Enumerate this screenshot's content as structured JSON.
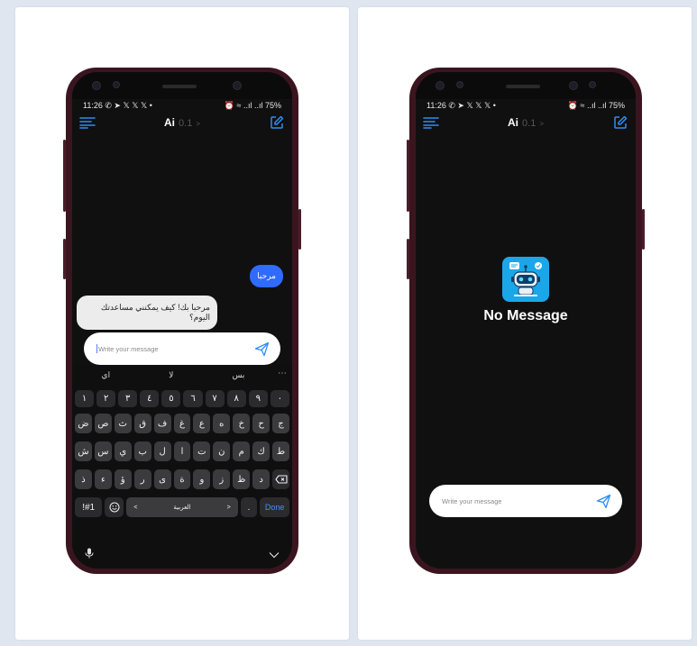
{
  "colors": {
    "accent": "#2f6bff",
    "icon_blue": "#2e8ef3",
    "screen_bg": "#101010",
    "frame": "#3a1520"
  },
  "status": {
    "time": "11:26",
    "left_icons": "✆ ➤ 𝕏 𝕏 𝕏 •",
    "right_icons": "⏰ ≈ ..ıl ..ıl",
    "battery": "75%"
  },
  "appbar": {
    "title": "Ai",
    "version": "0.1",
    "version_arrow": ">",
    "menu_icon": "menu-icon",
    "edit_icon": "edit-icon"
  },
  "chat": {
    "user_message": "مرحبا",
    "ai_message": "مرحبا بك! كيف يمكنني مساعدتك اليوم؟"
  },
  "input": {
    "placeholder": "Write your message",
    "send_icon": "send-icon"
  },
  "keyboard": {
    "suggestions": [
      "اي",
      "لا",
      "بس"
    ],
    "more": "⋯",
    "digits": [
      "١",
      "٢",
      "٣",
      "٤",
      "٥",
      "٦",
      "٧",
      "٨",
      "٩",
      "٠"
    ],
    "row1": [
      "ض",
      "ص",
      "ث",
      "ق",
      "ف",
      "غ",
      "ع",
      "ه",
      "خ",
      "ح",
      "ج"
    ],
    "row2": [
      "ش",
      "س",
      "ي",
      "ب",
      "ل",
      "ا",
      "ت",
      "ن",
      "م",
      "ك",
      "ط"
    ],
    "row3": [
      "ذ",
      "ء",
      "ؤ",
      "ر",
      "ى",
      "ة",
      "و",
      "ز",
      "ظ",
      "د"
    ],
    "symbols": "!#1",
    "space": "العربية",
    "space_left": "<",
    "space_right": ">",
    "punct": ".",
    "done": "Done"
  },
  "empty_state": {
    "title": "No Message",
    "icon": "robot-icon"
  }
}
